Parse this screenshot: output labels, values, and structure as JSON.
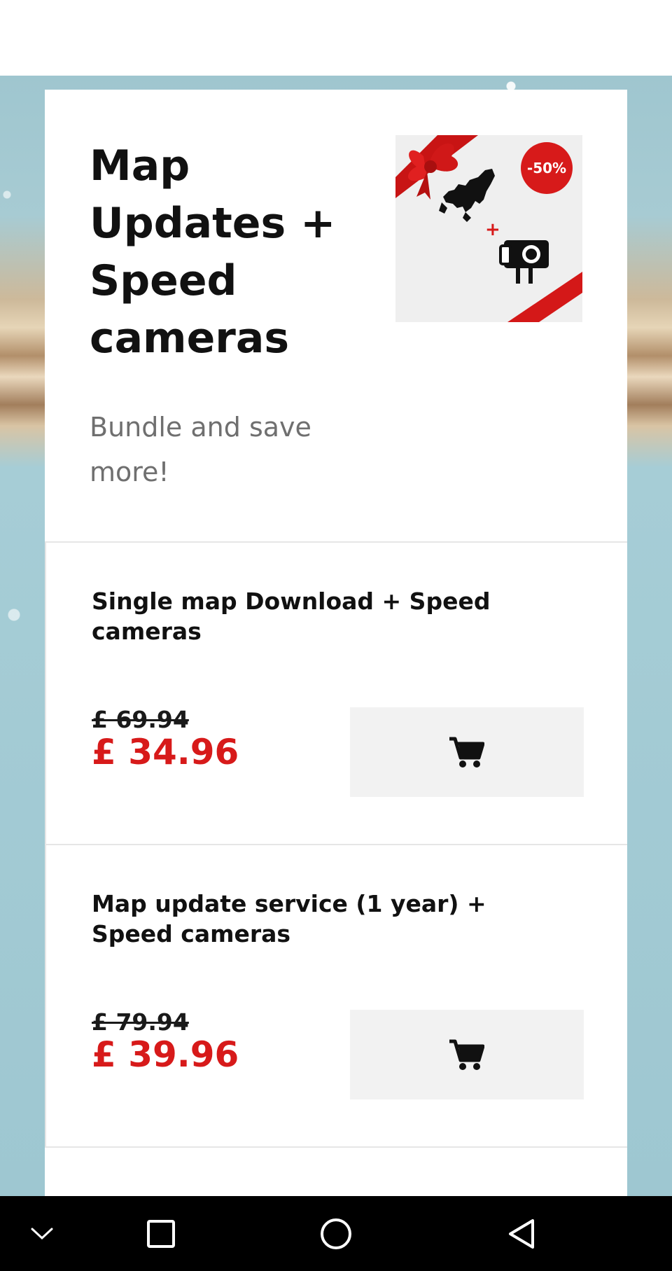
{
  "product": {
    "title": "Map Updates + Speed cameras",
    "subtitle": "Bundle and save more!",
    "image": {
      "badge": "-50%",
      "plus_symbol": "+",
      "icons": [
        "ribbon-bow-icon",
        "europe-map-icon",
        "speed-camera-icon"
      ]
    }
  },
  "offers": [
    {
      "title": "Single map Download + Speed cameras",
      "old_price": "£ 69.94",
      "price": "£ 34.96",
      "button_icon": "cart-icon"
    },
    {
      "title": "Map update service (1 year) + Speed cameras",
      "old_price": "£ 79.94",
      "price": "£ 39.96",
      "button_icon": "cart-icon"
    }
  ],
  "navbar": {
    "icons": [
      "chevron-down-icon",
      "recents-square-icon",
      "home-circle-icon",
      "back-triangle-icon"
    ]
  },
  "colors": {
    "accent_red": "#d71a1a",
    "button_bg": "#f2f2f2",
    "text_dark": "#111111",
    "text_muted": "#6f6f6f"
  }
}
